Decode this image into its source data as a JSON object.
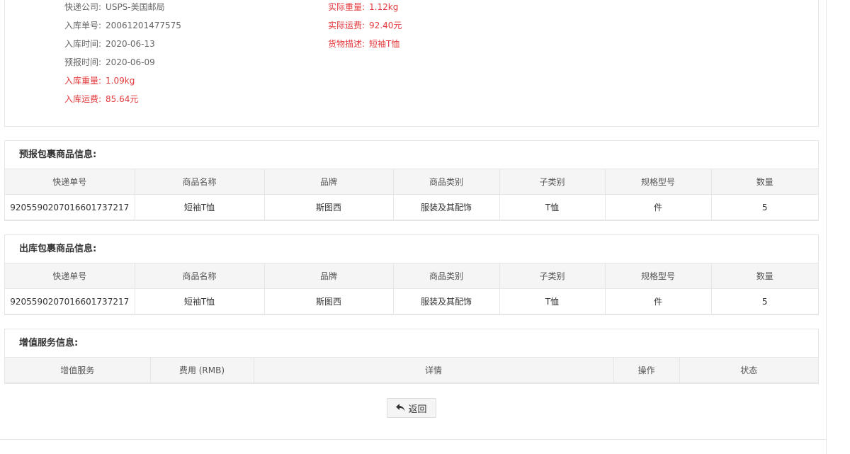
{
  "shipment_info": {
    "left": [
      {
        "label": "快递公司:",
        "value": "USPS-美国邮局",
        "highlight": false
      },
      {
        "label": "入库单号:",
        "value": "20061201477575",
        "highlight": false
      },
      {
        "label": "入库时间:",
        "value": "2020-06-13",
        "highlight": false
      },
      {
        "label": "预报时间:",
        "value": "2020-06-09",
        "highlight": false
      },
      {
        "label": "入库重量:",
        "value": "1.09kg",
        "highlight": true
      },
      {
        "label": "入库运费:",
        "value": "85.64元",
        "highlight": true
      }
    ],
    "right": [
      {
        "label": "实际重量:",
        "value": "1.12kg",
        "highlight": true
      },
      {
        "label": "实际运费:",
        "value": "92.40元",
        "highlight": true
      },
      {
        "label": "货物描述:",
        "value": "短袖T恤",
        "highlight": true
      }
    ]
  },
  "forecast_section": {
    "title": "预报包裹商品信息:",
    "columns": [
      "快递单号",
      "商品名称",
      "品牌",
      "商品类别",
      "子类别",
      "规格型号",
      "数量"
    ],
    "rows": [
      [
        "9205590207016601737217",
        "短袖T恤",
        "斯图西",
        "服装及其配饰",
        "T恤",
        "件",
        "5"
      ]
    ]
  },
  "outbound_section": {
    "title": "出库包裹商品信息:",
    "columns": [
      "快递单号",
      "商品名称",
      "品牌",
      "商品类别",
      "子类别",
      "规格型号",
      "数量"
    ],
    "rows": [
      [
        "9205590207016601737217",
        "短袖T恤",
        "斯图西",
        "服装及其配饰",
        "T恤",
        "件",
        "5"
      ]
    ]
  },
  "value_added_section": {
    "title": "增值服务信息:",
    "columns": [
      "增值服务",
      "费用 (RMB)",
      "详情",
      "操作",
      "状态"
    ]
  },
  "back_button": {
    "label": "返回",
    "icon": "reply-arrow-icon"
  },
  "colors": {
    "highlight": "#e4393c",
    "header_bg": "#f5f5f5",
    "border": "#e6e6e6"
  }
}
